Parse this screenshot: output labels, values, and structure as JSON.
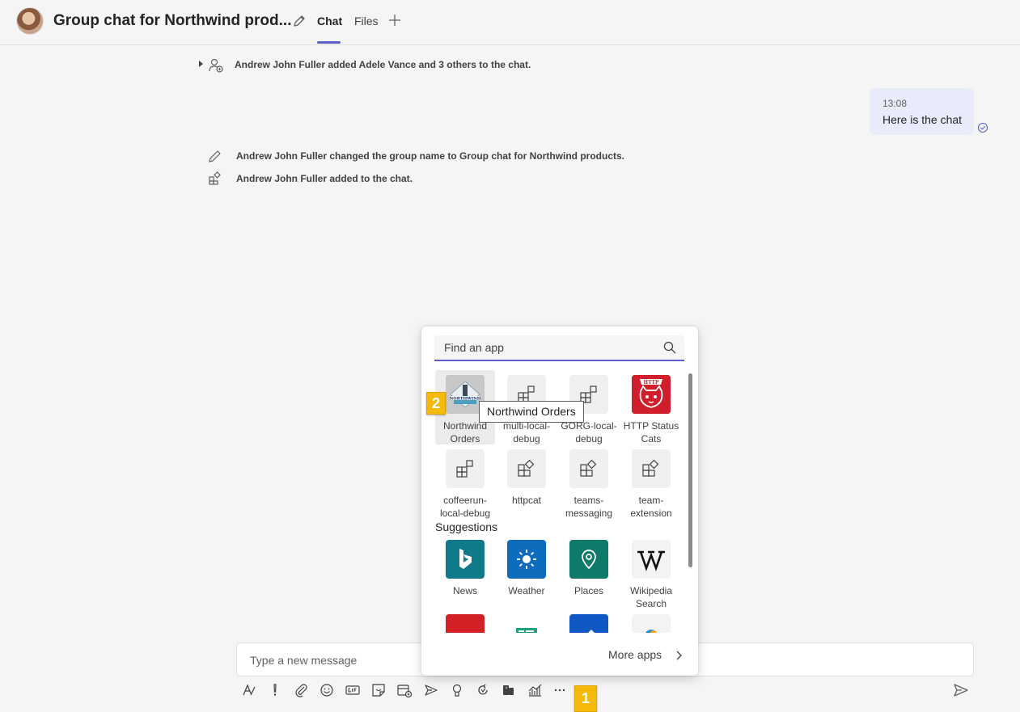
{
  "header": {
    "title": "Group chat for Northwind prod...",
    "tabs": [
      {
        "label": "Chat"
      },
      {
        "label": "Files"
      }
    ]
  },
  "events": [
    {
      "text": "Andrew John Fuller added Adele Vance and 3 others to the chat."
    },
    {
      "text": "Andrew John Fuller changed the group name to Group chat for Northwind products."
    },
    {
      "text": "Andrew John Fuller added to the chat."
    }
  ],
  "message": {
    "time": "13:08",
    "text": "Here is the chat"
  },
  "compose": {
    "placeholder": "Type a new message"
  },
  "app_picker": {
    "search_placeholder": "Find an app",
    "apps": [
      {
        "line1": "Northwind",
        "line2": "Orders"
      },
      {
        "line1": "multi-local-",
        "line2": "debug"
      },
      {
        "line1": "GORG-local-",
        "line2": "debug"
      },
      {
        "line1": "HTTP Status",
        "line2": "Cats"
      },
      {
        "line1": "coffeerun-",
        "line2": "local-debug"
      },
      {
        "line1": "httpcat",
        "line2": ""
      },
      {
        "line1": "teams-",
        "line2": "messaging"
      },
      {
        "line1": "team-",
        "line2": "extension"
      }
    ],
    "suggestions_label": "Suggestions",
    "suggestions": [
      {
        "line1": "News",
        "line2": ""
      },
      {
        "line1": "Weather",
        "line2": ""
      },
      {
        "line1": "Places",
        "line2": ""
      },
      {
        "line1": "Wikipedia",
        "line2": "Search"
      }
    ],
    "more_apps": "More apps",
    "tooltip": "Northwind Orders"
  },
  "markers": {
    "one": "1",
    "two": "2"
  },
  "colors": {
    "accent": "#5b5fc7",
    "marker": "#f5b90a",
    "bing": "#0f7a8a",
    "weather": "#0f6cbd",
    "places": "#0e7a6a",
    "http_cats": "#d01e2a"
  }
}
